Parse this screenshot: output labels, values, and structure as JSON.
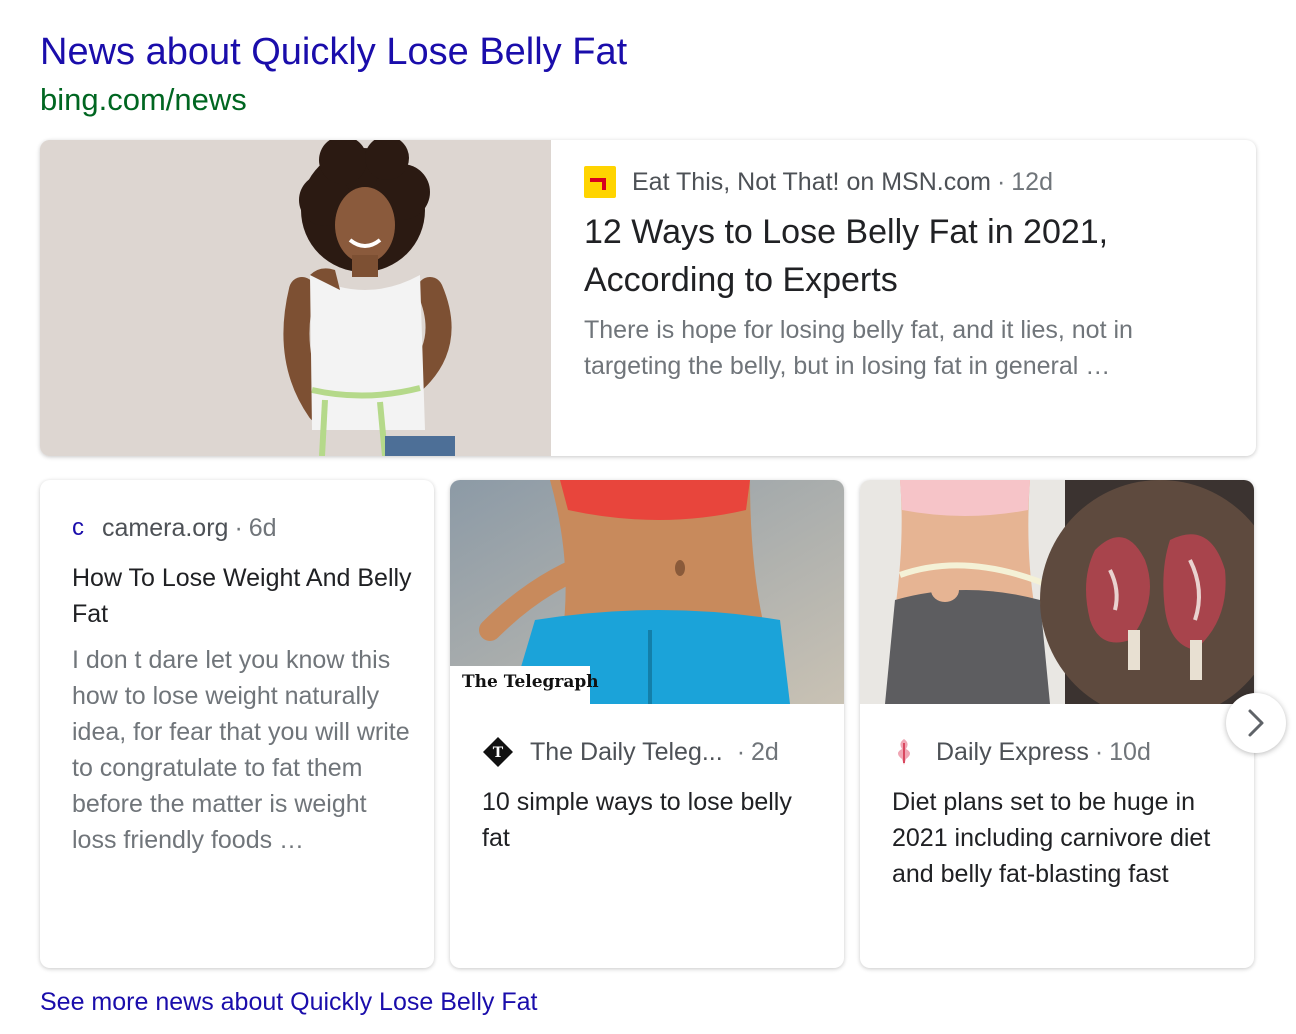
{
  "header": {
    "title": "News about Quickly Lose Belly Fat",
    "url": "bing.com/news"
  },
  "featured": {
    "source": "Eat This, Not That! on MSN.com",
    "age": "12d",
    "title": "12 Ways to Lose Belly Fat in 2021, According to Experts",
    "snippet": "There is hope for losing belly fat, and it lies, not in targeting the belly, but in losing fat in general …",
    "source_icon": "msn-logo"
  },
  "cards": [
    {
      "logo_text": "c",
      "source": "camera.org",
      "age": "6d",
      "title": "How To Lose Weight And Belly Fat",
      "snippet": "I don t dare let you know this how to lose weight naturally idea, for fear that you will write to congratulate to fat them before the matter is weight loss friendly foods …"
    },
    {
      "source": "The Daily Teleg...",
      "age": "2d",
      "title": "10 simple ways to lose belly fat",
      "watermark": "The Telegraph",
      "source_icon": "telegraph-logo"
    },
    {
      "source": "Daily Express",
      "age": "10d",
      "title": "Diet plans set to be huge in 2021 including carnivore diet and belly fat-blasting fast",
      "source_icon": "express-logo"
    }
  ],
  "separator": "·",
  "next_icon": "chevron-right-icon",
  "see_more": "See more news about Quickly Lose Belly Fat",
  "colors": {
    "link": "#1a0dab",
    "url": "#006621",
    "snippet": "#70757a",
    "msn_yellow": "#ffd400"
  }
}
